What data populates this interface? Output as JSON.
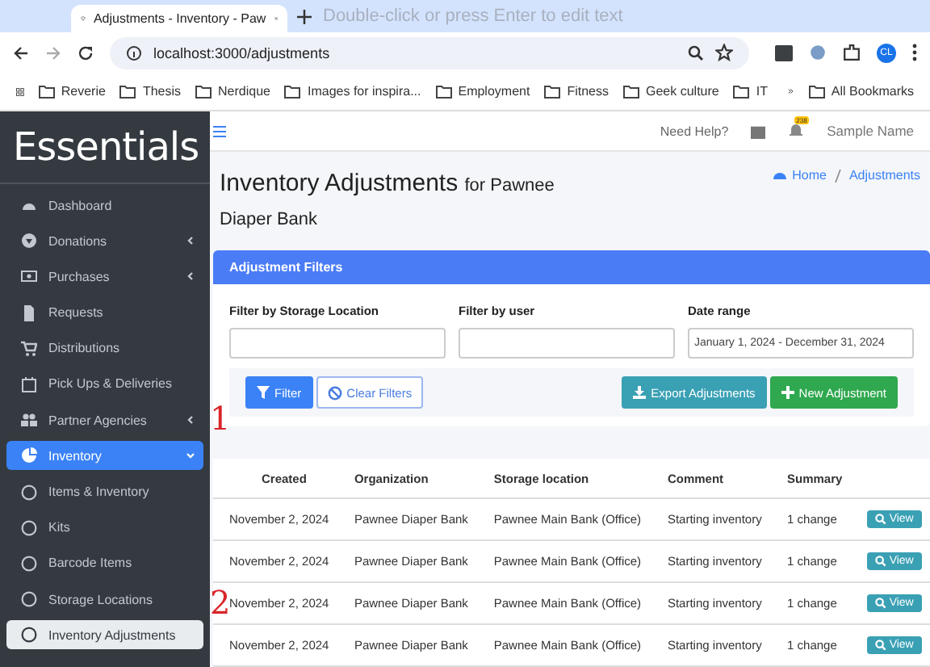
{
  "browser": {
    "tab_title": "Adjustments - Inventory - Paw",
    "edit_hint": "Double-click or press Enter to edit text",
    "url": "localhost:3000/adjustments",
    "profile": "CL",
    "bookmarks": [
      "Reverie",
      "Thesis",
      "Nerdique",
      "Images for inspira...",
      "Employment",
      "Fitness",
      "Geek culture",
      "IT"
    ],
    "all_bookmarks": "All Bookmarks"
  },
  "sidebar": {
    "logo": "Essentials",
    "items": [
      {
        "label": "Dashboard",
        "selected": false,
        "has_caret": false
      },
      {
        "label": "Donations",
        "selected": false,
        "has_caret": true
      },
      {
        "label": "Purchases",
        "selected": false,
        "has_caret": true
      },
      {
        "label": "Requests",
        "selected": false,
        "has_caret": false
      },
      {
        "label": "Distributions",
        "selected": false,
        "has_caret": false
      },
      {
        "label": "Pick Ups & Deliveries",
        "selected": false,
        "has_caret": false
      },
      {
        "label": "Partner Agencies",
        "selected": false,
        "has_caret": true
      },
      {
        "label": "Inventory",
        "selected": true,
        "has_caret": true,
        "expanded": true,
        "children": [
          {
            "label": "Items & Inventory",
            "selected": false
          },
          {
            "label": "Kits",
            "selected": false
          },
          {
            "label": "Barcode Items",
            "selected": false
          },
          {
            "label": "Storage Locations",
            "selected": false
          },
          {
            "label": "Inventory Adjustments",
            "selected": true
          }
        ]
      }
    ]
  },
  "navbar": {
    "help": "Need Help?",
    "badge": "238",
    "user": "Sample Name"
  },
  "page": {
    "title": "Inventory Adjustments",
    "subtitle": "for Pawnee Diaper Bank",
    "breadcrumb": [
      "Home",
      "Adjustments"
    ]
  },
  "filters": {
    "header": "Adjustment Filters",
    "fields": [
      {
        "label": "Filter by Storage Location"
      },
      {
        "label": "Filter by user"
      },
      {
        "label": "Date range",
        "value": "January 1, 2024 - December 31, 2024"
      }
    ],
    "buttons": [
      {
        "label": "Filter",
        "kind": "filter"
      },
      {
        "label": "Clear Filters",
        "kind": "clear"
      },
      {
        "label": "Export Adjustments",
        "kind": "export"
      },
      {
        "label": "New Adjustment",
        "kind": "new"
      }
    ]
  },
  "table": {
    "columns": [
      "Created",
      "Organization",
      "Storage location",
      "Comment",
      "Summary"
    ],
    "rows": [
      {
        "cells": [
          "November 2, 2024",
          "Pawnee Diaper Bank",
          "Pawnee Main Bank (Office)",
          "Starting inventory",
          "1 change"
        ],
        "action": "View"
      },
      {
        "cells": [
          "November 2, 2024",
          "Pawnee Diaper Bank",
          "Pawnee Main Bank (Office)",
          "Starting inventory",
          "1 change"
        ],
        "action": "View"
      },
      {
        "cells": [
          "November 2, 2024",
          "Pawnee Diaper Bank",
          "Pawnee Main Bank (Office)",
          "Starting inventory",
          "1 change"
        ],
        "action": "View"
      },
      {
        "cells": [
          "November 2, 2024",
          "Pawnee Diaper Bank",
          "Pawnee Main Bank (Office)",
          "Starting inventory",
          "1 change"
        ],
        "action": "View"
      }
    ]
  },
  "annotations": [
    "1",
    "2"
  ]
}
